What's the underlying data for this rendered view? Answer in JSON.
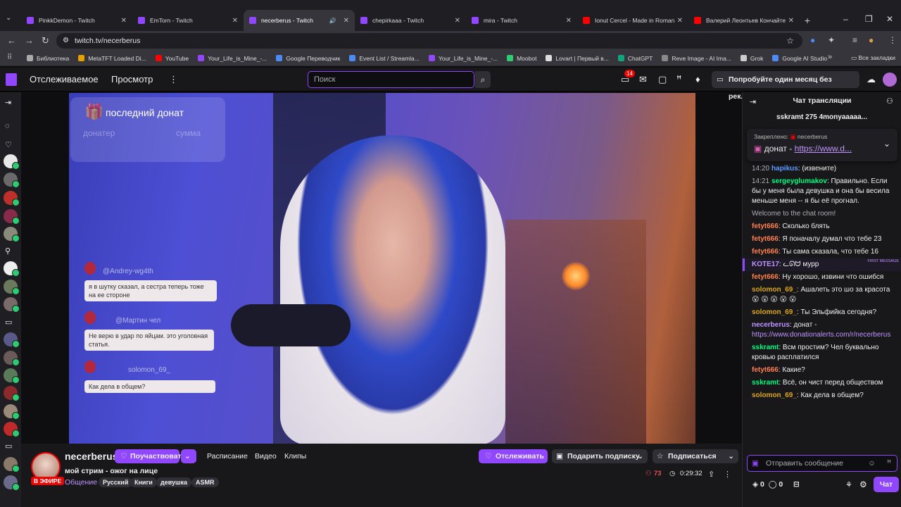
{
  "browser": {
    "tabs": [
      {
        "title": "PinkkDemon - Twitch",
        "color": "#9147ff"
      },
      {
        "title": "EmTorn - Twitch",
        "color": "#9147ff"
      },
      {
        "title": "necerberus - Twitch",
        "color": "#9147ff",
        "active": true
      },
      {
        "title": "chepirkaaa - Twitch",
        "color": "#9147ff"
      },
      {
        "title": "mira - Twitch",
        "color": "#9147ff"
      },
      {
        "title": "Ionut Cercel - Made in Romania",
        "color": "#ff0000"
      },
      {
        "title": "Валерий Леонтьев Кончайте, ...",
        "color": "#ff0000"
      }
    ],
    "url": "twitch.tv/necerberus",
    "bookmarks": [
      "Библиотека",
      "MetaTFT Loaded Di...",
      "YouTube",
      "Your_Life_is_Mine_-...",
      "Google Переводчик",
      "Event List / Streamla...",
      "Your_Life_is_Mine_-...",
      "Moobot",
      "Lovart | Первый в...",
      "ChatGPT",
      "Reve Image - AI Ima...",
      "Grok",
      "Google AI Studio"
    ],
    "all_bookmarks": "Все закладки"
  },
  "twitch": {
    "nav": {
      "following": "Отслеживаемое",
      "browse": "Просмотр",
      "more": "⋮"
    },
    "search_placeholder": "Поиск",
    "notif_count": "14",
    "prime": "Попробуйте один месяц без рекламы"
  },
  "overlay": {
    "donation_title": "последний донат",
    "donor_label": "донатер",
    "amount_label": "сумма",
    "chat": [
      {
        "user": "@Andrey-wg4th",
        "text": "я в шутку сказал, а сестра теперь тоже на ее стороне"
      },
      {
        "user": "@Мартин чел",
        "text": "Не верю в удар по яйцам. это уголовная статья."
      },
      {
        "user": "solomon_69_",
        "text": "Как дела в общем?"
      }
    ]
  },
  "stream": {
    "channel": "necerberus",
    "live": "В ЭФИРЕ",
    "title": "мой стрим - ожог на лице",
    "category": "Общение",
    "tags": [
      "Русский",
      "Книги",
      "девушка",
      "ASMR"
    ],
    "hype": "Поучаствовать",
    "links": [
      "Расписание",
      "Видео",
      "Клипы"
    ],
    "follow": "Отслеживать",
    "gift": "Подарить подписку",
    "subscribe": "Подписаться",
    "viewers": "73",
    "uptime": "0:29:32"
  },
  "chat": {
    "header": "Чат трансляции",
    "gift_bar": "sskramt 275  4monyaaaaa...",
    "pinned_label": "Закреплено:",
    "pinned_user": "necerberus",
    "pinned_text": "донат - ",
    "pinned_link": "https://www.d...",
    "messages": [
      {
        "time": "14:20",
        "user": "hapikus",
        "color": "#5b99ff",
        "text": "(извените)"
      },
      {
        "time": "14:21",
        "user": "sergeyglumakov",
        "color": "#00ff7f",
        "text": "Правильно. Если бы у меня была девушка и она бы весила меньше меня -- я бы её прогнал."
      },
      {
        "sys": true,
        "text": "Welcome to the chat room!"
      },
      {
        "user": "fetyt666",
        "color": "#ff7f50",
        "text": "Сколько блять"
      },
      {
        "user": "fetyt666",
        "color": "#ff7f50",
        "text": "Я поначалу думал что тебе 23"
      },
      {
        "user": "fetyt666",
        "color": "#ff7f50",
        "text": "Ты сама сказала, что тебе 16"
      },
      {
        "first": true,
        "fm": "FIRST MESSAGE",
        "user": "KOTE17",
        "color": "#bf94ff",
        "text": "ᓚᘏᗢ мурр"
      },
      {
        "user": "fetyt666",
        "color": "#ff7f50",
        "text": "Ну хорошо, извини что ошибся"
      },
      {
        "user": "solomon_69_",
        "color": "#daa520",
        "text": "Ашалеть это шо за красота 😮 😮 😮 😮 😮"
      },
      {
        "user": "solomon_69_",
        "color": "#daa520",
        "text": "Ты Эльфийка сегодня?"
      },
      {
        "user": "necerberus",
        "color": "#bf94ff",
        "text": "донат - ",
        "link": "https://www.donationalerts.com/r/necerberus"
      },
      {
        "user": "sskramt",
        "color": "#00ff7f",
        "text": "Всм простим? Чел буквально кровью расплатился"
      },
      {
        "user": "fetyt666",
        "color": "#ff7f50",
        "text": "Какие?"
      },
      {
        "user": "sskramt",
        "color": "#00ff7f",
        "text": "Всё, он чист перед обществом"
      },
      {
        "user": "solomon_69_",
        "color": "#daa520",
        "text": "Как дела в общем?"
      }
    ],
    "input_placeholder": "Отправить сообщение",
    "points": "0",
    "bits": "0",
    "send": "Чат"
  }
}
